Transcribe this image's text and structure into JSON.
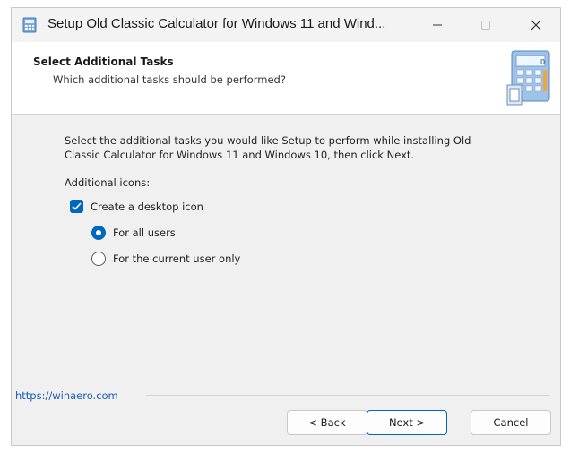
{
  "window": {
    "title": "Setup Old Classic Calculator for Windows 11 and Wind..."
  },
  "header": {
    "title": "Select Additional Tasks",
    "subtitle": "Which additional tasks should be performed?"
  },
  "body": {
    "instructions_line1": "Select the additional tasks you would like Setup to perform while installing Old",
    "instructions_line2": "Classic Calculator for Windows 11 and Windows 10, then click Next.",
    "section_label": "Additional icons:",
    "desktop_icon": {
      "label": "Create a desktop icon",
      "checked": true
    },
    "radio_all_users": {
      "label": "For all users",
      "selected": true
    },
    "radio_current_user": {
      "label": "For the current user only",
      "selected": false
    }
  },
  "footer": {
    "link": "https://winaero.com"
  },
  "buttons": {
    "back": "< Back",
    "next": "Next >",
    "cancel": "Cancel"
  },
  "colors": {
    "accent": "#0067c0"
  }
}
